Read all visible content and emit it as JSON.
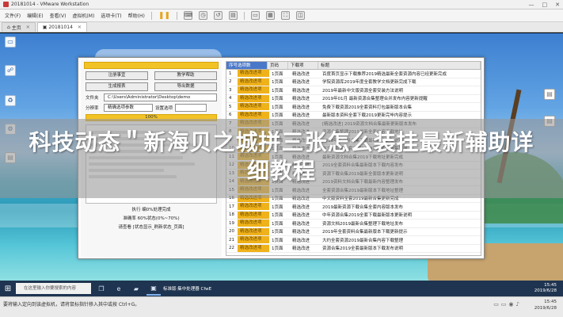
{
  "vmware": {
    "title": "20181014 - VMware Workstation",
    "window_buttons": [
      "—",
      "□",
      "✕"
    ],
    "menu": [
      "文件(F)",
      "编辑(E)",
      "查看(V)",
      "虚拟机(M)",
      "选项卡(T)",
      "帮助(H)"
    ],
    "tabs": [
      {
        "label": "主页",
        "active": false
      },
      {
        "label": "20181014",
        "active": true
      }
    ]
  },
  "app": {
    "buttons_row1": [
      "注册事宜",
      "教学帮助"
    ],
    "buttons_row2": [
      "生成报表",
      "导出数据"
    ],
    "path_label": "文件夹",
    "path_value": "C:\\Users\\Administrator\\Desktop\\demo",
    "score_label": "分辨率",
    "score_value": "精确选项参数",
    "score_label2": "设置选项",
    "progress_text": "100%",
    "status_lines": [
      "执行 编0%处理完成",
      "准确率 60%状态(0%~70%)",
      "请查看 [状态显示_刷新状态_页面]"
    ]
  },
  "table": {
    "headers": [
      "序号选项数",
      "页码",
      "下载项",
      "标题"
    ],
    "rows": [
      {
        "n": "1",
        "status": "精选改进项",
        "page": "1页面",
        "dl": "精选改进",
        "title": "百度首页显示下载推荐2019精选最新全套资源内容已经更新完成"
      },
      {
        "n": "2",
        "status": "精选改进项",
        "page": "1页面",
        "dl": "精选改进",
        "title": "学院资源库2019年度全套教学文档更新完成下载"
      },
      {
        "n": "3",
        "status": "精选改进项",
        "page": "1页面",
        "dl": "精选改进",
        "title": "2019年最新中文版资源全套安装方法说明"
      },
      {
        "n": "4",
        "status": "精选改进项",
        "page": "1页面",
        "dl": "精选改进",
        "title": "2019年01月 最新资源合集整理合并发布内容更新提醒"
      },
      {
        "n": "5",
        "status": "精选改进项",
        "page": "1页面",
        "dl": "精选改进",
        "title": "免费下载资源2019全套资料打包最新版本合集"
      },
      {
        "n": "6",
        "status": "精选改进项",
        "page": "1页面",
        "dl": "精选改进",
        "title": "最新版本资料全套下载2019更新完毕内容提示"
      },
      {
        "n": "7",
        "status": "精选改进项",
        "page": "1页面",
        "dl": "精选改进",
        "title": "[精选改进] 2019资源文档合集最新更新版本发布"
      },
      {
        "n": "8",
        "status": "精选改进项",
        "page": "1页面",
        "dl": "精选改进",
        "title": "资源合集整理2019最新全套内容下载地址"
      },
      {
        "n": "9",
        "status": "精选改进项",
        "page": "1页面",
        "dl": "精选改进",
        "title": "2019年度资料合集下载最新版本更新说明"
      },
      {
        "n": "10",
        "status": "精选改进项",
        "page": "1页面",
        "dl": "精选改进",
        "title": "中文版资源全套下载2019更新内容合集整理"
      },
      {
        "n": "11",
        "status": "精选改进项",
        "page": "1页面",
        "dl": "精选改进",
        "title": "最新资源文档合集2019下载地址更新完成"
      },
      {
        "n": "12",
        "status": "精选改进项",
        "page": "1页面",
        "dl": "精选改进",
        "title": "2019全套资料合集最新版本下载内容发布"
      },
      {
        "n": "13",
        "status": "精选改进项",
        "page": "1页面",
        "dl": "精选改进",
        "title": "资源下载合集2019最新全套版本更新说明"
      },
      {
        "n": "14",
        "status": "精选改进项",
        "page": "1页面",
        "dl": "精选改进",
        "title": "2019资料文档合集下载最新内容整理发布"
      },
      {
        "n": "15",
        "status": "精选改进项",
        "page": "1页面",
        "dl": "精选改进",
        "title": "全套资源合集2019最新版本下载地址整理"
      },
      {
        "n": "16",
        "status": "精选改进项",
        "page": "1页面",
        "dl": "精选改进",
        "title": "中文版资料全套2019最新合集更新完成"
      },
      {
        "n": "17",
        "status": "精选改进项",
        "page": "1页面",
        "dl": "精选改进",
        "title": "2019最新资源下载合集全套内容版本发布"
      },
      {
        "n": "18",
        "status": "精选改进项",
        "page": "1页面",
        "dl": "精选改进",
        "title": "中年资源合集2019全套下载最新版本更新说明"
      },
      {
        "n": "19",
        "status": "精选改进项",
        "page": "1页面",
        "dl": "精选改进",
        "title": "资源文档2019最新合集整理下载地址发布"
      },
      {
        "n": "20",
        "status": "精选改进项",
        "page": "1页面",
        "dl": "精选改进",
        "title": "2019年全套资料合集最新版本下载更新提示"
      },
      {
        "n": "21",
        "status": "精选改进项",
        "page": "1页面",
        "dl": "精选改进",
        "title": "大约全套资源2019最新合集内容下载整理"
      },
      {
        "n": "22",
        "status": "精选改进项",
        "page": "1页面",
        "dl": "精选改进",
        "title": "资源合集2019全套最新版本下载发布说明"
      }
    ]
  },
  "headline": "科技动态＂新海贝之城拼三张怎么装挂最新辅助详细教程",
  "taskbar": {
    "search_placeholder": "在这里输入你要搜索的内容",
    "active_app": "标准版·集中处理器 CfwE",
    "time": "15:45",
    "date": "2019/6/28"
  },
  "host": {
    "hint": "要将输入定向到该虚拟机，请将鼠标指针移入其中或按 Ctrl+G。",
    "time": "15:45",
    "date": "2019/6/28"
  }
}
